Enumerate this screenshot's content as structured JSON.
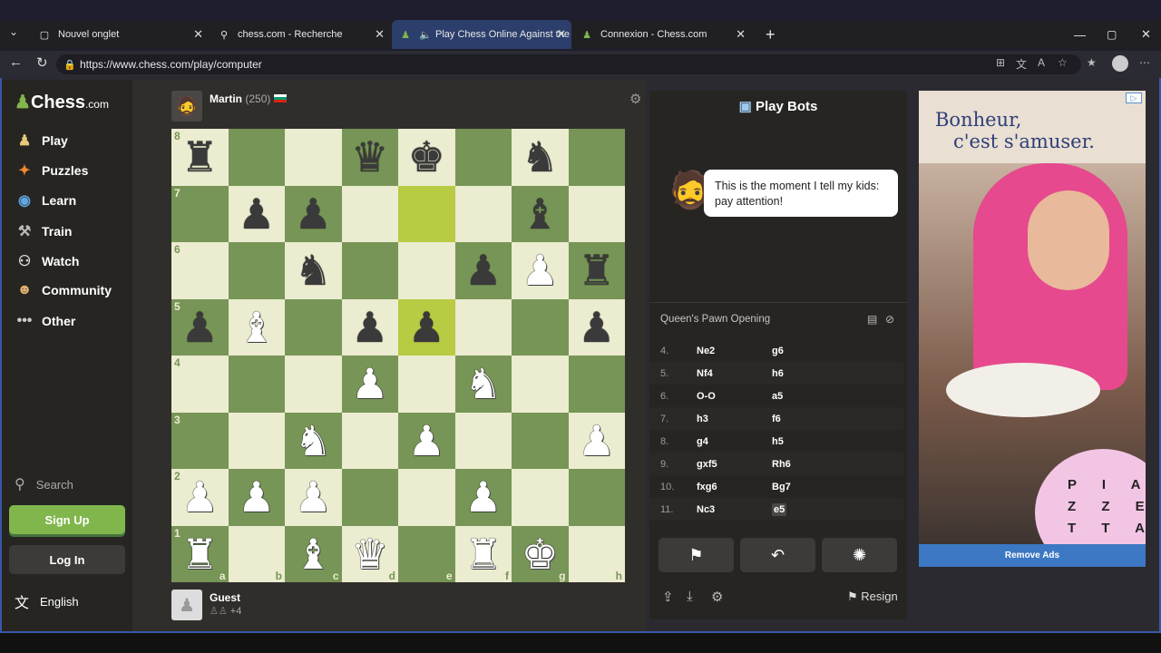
{
  "browser": {
    "tabs": [
      {
        "title": "Nouvel onglet",
        "icon": "page-icon"
      },
      {
        "title": "chess.com - Recherche",
        "icon": "search-icon"
      },
      {
        "title": "Play Chess Online Against the",
        "icon": "chess-pawn-icon"
      },
      {
        "title": "Connexion - Chess.com",
        "icon": "chess-pawn-icon"
      }
    ],
    "url": "https://www.chess.com/play/computer"
  },
  "sidebar": {
    "logo": "Chess",
    "logo_suffix": ".com",
    "items": [
      {
        "label": "Play",
        "icon": "play-icon"
      },
      {
        "label": "Puzzles",
        "icon": "puzzle-icon"
      },
      {
        "label": "Learn",
        "icon": "learn-icon"
      },
      {
        "label": "Train",
        "icon": "train-icon"
      },
      {
        "label": "Watch",
        "icon": "watch-icon"
      },
      {
        "label": "Community",
        "icon": "community-icon"
      },
      {
        "label": "Other",
        "icon": "more-icon"
      }
    ],
    "search_label": "Search",
    "signup_label": "Sign Up",
    "login_label": "Log In",
    "language_label": "English"
  },
  "game": {
    "opponent": {
      "name": "Martin",
      "rating": "(250)"
    },
    "player": {
      "name": "Guest",
      "captured_extra": "+4"
    },
    "board": [
      [
        "♜",
        "",
        "",
        "♛",
        "♚",
        "",
        "♞",
        ""
      ],
      [
        "",
        "♟",
        "♟",
        "",
        "",
        "",
        "♝",
        ""
      ],
      [
        "",
        "",
        "♞",
        "",
        "",
        "♟",
        "♙",
        "♜"
      ],
      [
        "♟",
        "♗",
        "",
        "♟",
        "♟",
        "",
        "",
        "♟"
      ],
      [
        "",
        "",
        "",
        "♙",
        "",
        "♘",
        "",
        ""
      ],
      [
        "",
        "",
        "♘",
        "",
        "♙",
        "",
        "",
        "♙"
      ],
      [
        "♙",
        "♙",
        "♙",
        "",
        "",
        "♙",
        "",
        ""
      ],
      [
        "♖",
        "",
        "♗",
        "♕",
        "",
        "♖",
        "♔",
        ""
      ]
    ],
    "ranks": [
      "8",
      "7",
      "6",
      "5",
      "4",
      "3",
      "2",
      "1"
    ],
    "files": [
      "a",
      "b",
      "c",
      "d",
      "e",
      "f",
      "g",
      "h"
    ]
  },
  "panel": {
    "title": "Play Bots",
    "bot_message": "This is the moment I tell my kids: pay attention!",
    "opening": "Queen's Pawn Opening",
    "moves": [
      {
        "n": "4.",
        "w": "Ne2",
        "b": "g6"
      },
      {
        "n": "5.",
        "w": "Nf4",
        "b": "h6"
      },
      {
        "n": "6.",
        "w": "O-O",
        "b": "a5"
      },
      {
        "n": "7.",
        "w": "h3",
        "b": "f6"
      },
      {
        "n": "8.",
        "w": "g4",
        "b": "h5"
      },
      {
        "n": "9.",
        "w": "gxf5",
        "b": "Rh6"
      },
      {
        "n": "10.",
        "w": "fxg6",
        "b": "Bg7"
      },
      {
        "n": "11.",
        "w": "Nc3",
        "b": "e5"
      }
    ],
    "resign_label": "Resign"
  },
  "ad": {
    "headline_1": "Bonheur,",
    "headline_2": "c'est s'amuser.",
    "brand": "PIAZZETTA",
    "remove_ads": "Remove Ads"
  }
}
